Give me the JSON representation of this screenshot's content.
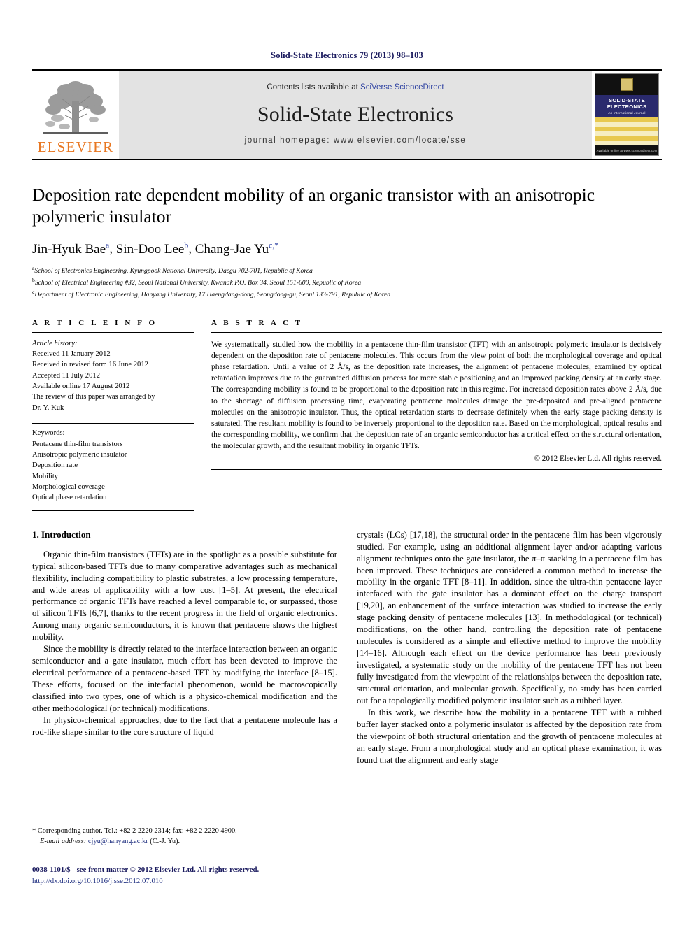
{
  "running_head": "Solid-State Electronics 79 (2013) 98–103",
  "masthead": {
    "publisher_name": "ELSEVIER",
    "contents_prefix": "Contents lists available at ",
    "contents_link": "SciVerse ScienceDirect",
    "journal_title": "Solid-State Electronics",
    "homepage": "journal homepage: www.elsevier.com/locate/sse",
    "cover": {
      "line1": "SOLID-STATE",
      "line2": "ELECTRONICS",
      "subtitle": "An International Journal",
      "footer": "Available online at www.sciencedirect.com"
    }
  },
  "title": "Deposition rate dependent mobility of an organic transistor with an anisotropic polymeric insulator",
  "authors": [
    {
      "name": "Jin-Hyuk Bae",
      "sup": "a"
    },
    {
      "name": "Sin-Doo Lee",
      "sup": "b"
    },
    {
      "name": "Chang-Jae Yu",
      "sup": "c,*"
    }
  ],
  "affiliations": [
    {
      "mark": "a",
      "text": "School of Electronics Engineering, Kyungpook National University, Daegu 702-701, Republic of Korea"
    },
    {
      "mark": "b",
      "text": "School of Electrical Engineering #32, Seoul National University, Kwanak P.O. Box 34, Seoul 151-600, Republic of Korea"
    },
    {
      "mark": "c",
      "text": "Department of Electronic Engineering, Hanyang University, 17 Haengdang-dong, Seongdong-gu, Seoul 133-791, Republic of Korea"
    }
  ],
  "article_info": {
    "heading": "A R T I C L E    I N F O",
    "history_label": "Article history:",
    "history": [
      "Received 11 January 2012",
      "Received in revised form 16 June 2012",
      "Accepted 11 July 2012",
      "Available online 17 August 2012",
      "The review of this paper was arranged by",
      "Dr. Y. Kuk"
    ],
    "keywords_label": "Keywords:",
    "keywords": [
      "Pentacene thin-film transistors",
      "Anisotropic polymeric insulator",
      "Deposition rate",
      "Mobility",
      "Morphological coverage",
      "Optical phase retardation"
    ]
  },
  "abstract": {
    "heading": "A B S T R A C T",
    "text": "We systematically studied how the mobility in a pentacene thin-film transistor (TFT) with an anisotropic polymeric insulator is decisively dependent on the deposition rate of pentacene molecules. This occurs from the view point of both the morphological coverage and optical phase retardation. Until a value of 2 Å/s, as the deposition rate increases, the alignment of pentacene molecules, examined by optical retardation improves due to the guaranteed diffusion process for more stable positioning and an improved packing density at an early stage. The corresponding mobility is found to be proportional to the deposition rate in this regime. For increased deposition rates above 2 Å/s, due to the shortage of diffusion processing time, evaporating pentacene molecules damage the pre-deposited and pre-aligned pentacene molecules on the anisotropic insulator. Thus, the optical retardation starts to decrease definitely when the early stage packing density is saturated. The resultant mobility is found to be inversely proportional to the deposition rate. Based on the morphological, optical results and the corresponding mobility, we confirm that the deposition rate of an organic semiconductor has a critical effect on the structural orientation, the molecular growth, and the resultant mobility in organic TFTs.",
    "copyright": "© 2012 Elsevier Ltd. All rights reserved."
  },
  "body": {
    "section_number_title": "1. Introduction",
    "left_paragraphs": [
      "Organic thin-film transistors (TFTs) are in the spotlight as a possible substitute for typical silicon-based TFTs due to many comparative advantages such as mechanical flexibility, including compatibility to plastic substrates, a low processing temperature, and wide areas of applicability with a low cost [1–5]. At present, the electrical performance of organic TFTs have reached a level comparable to, or surpassed, those of silicon TFTs [6,7], thanks to the recent progress in the field of organic electronics. Among many organic semiconductors, it is known that pentacene shows the highest mobility.",
      "Since the mobility is directly related to the interface interaction between an organic semiconductor and a gate insulator, much effort has been devoted to improve the electrical performance of a pentacene-based TFT by modifying the interface [8–15]. These efforts, focused on the interfacial phenomenon, would be macroscopically classified into two types, one of which is a physico-chemical modification and the other methodological (or technical) modifications.",
      "In physico-chemical approaches, due to the fact that a pentacene molecule has a rod-like shape similar to the core structure of liquid"
    ],
    "right_paragraphs": [
      "crystals (LCs) [17,18], the structural order in the pentacene film has been vigorously studied. For example, using an additional alignment layer and/or adapting various alignment techniques onto the gate insulator, the π–π stacking in a pentacene film has been improved. These techniques are considered a common method to increase the mobility in the organic TFT [8–11]. In addition, since the ultra-thin pentacene layer interfaced with the gate insulator has a dominant effect on the charge transport [19,20], an enhancement of the surface interaction was studied to increase the early stage packing density of pentacene molecules [13]. In methodological (or technical) modifications, on the other hand, controlling the deposition rate of pentacene molecules is considered as a simple and effective method to improve the mobility [14–16]. Although each effect on the device performance has been previously investigated, a systematic study on the mobility of the pentacene TFT has not been fully investigated from the viewpoint of the relationships between the deposition rate, structural orientation, and molecular growth. Specifically, no study has been carried out for a topologically modified polymeric insulator such as a rubbed layer.",
      "In this work, we describe how the mobility in a pentacene TFT with a rubbed buffer layer stacked onto a polymeric insulator is affected by the deposition rate from the viewpoint of both structural orientation and the growth of pentacene molecules at an early stage. From a morphological study and an optical phase examination, it was found that the alignment and early stage"
    ]
  },
  "footnote": {
    "corresponding": "* Corresponding author. Tel.: +82 2 2220 2314; fax: +82 2 2220 4900.",
    "email_label": "E-mail address:",
    "email": "cjyu@hanyang.ac.kr",
    "email_suffix": "(C.-J. Yu)."
  },
  "page_footer": {
    "issn_line": "0038-1101/$ - see front matter © 2012 Elsevier Ltd. All rights reserved.",
    "doi": "http://dx.doi.org/10.1016/j.sse.2012.07.010"
  },
  "colors": {
    "link_blue": "#1f2f80",
    "header_navy": "#1a1a5e",
    "elsevier_orange": "#E87722",
    "masthead_gray": "#e3e3e3"
  }
}
